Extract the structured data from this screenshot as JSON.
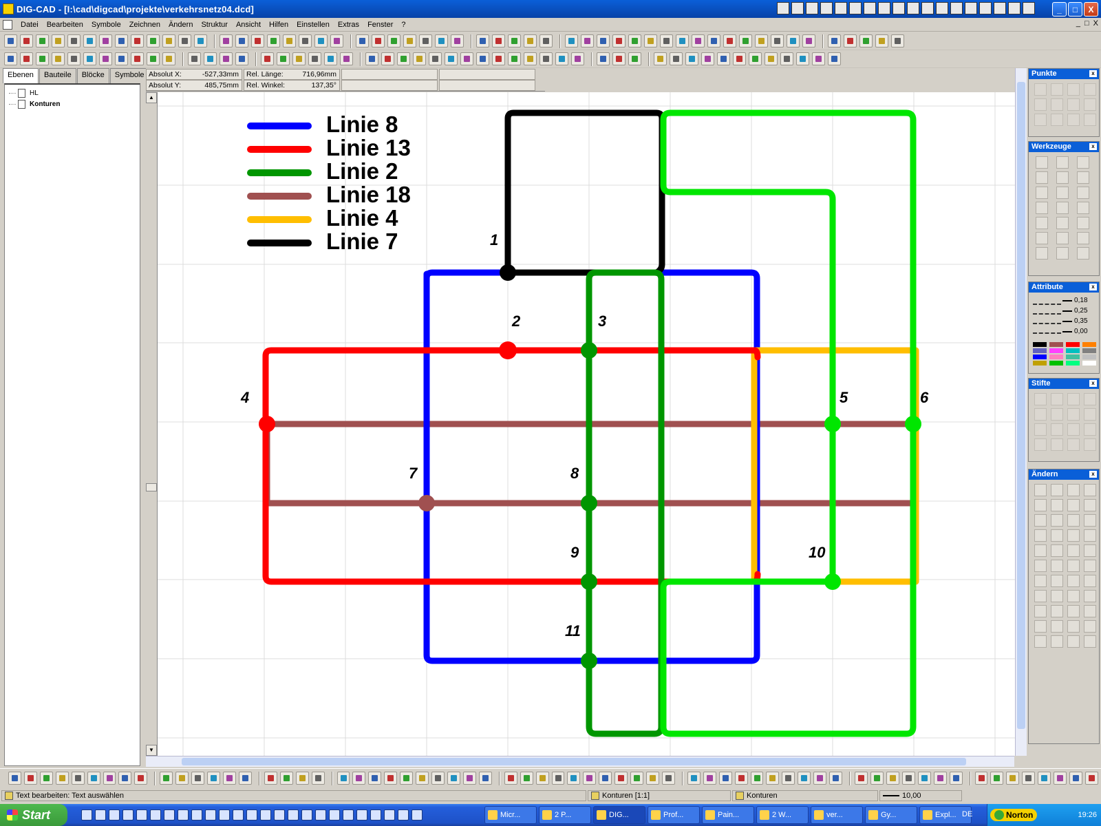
{
  "window": {
    "title": "DIG-CAD - [I:\\cad\\digcad\\projekte\\verkehrsnetz04.dcd]",
    "buttons": [
      "_",
      "□",
      "X"
    ]
  },
  "menu": {
    "items": [
      "Datei",
      "Bearbeiten",
      "Symbole",
      "Zeichnen",
      "Ändern",
      "Struktur",
      "Ansicht",
      "Hilfen",
      "Einstellen",
      "Extras",
      "Fenster",
      "?"
    ],
    "mdi_controls": [
      "_",
      "□",
      "X"
    ]
  },
  "left_panel": {
    "tabs": [
      "Ebenen",
      "Bauteile",
      "Blöcke",
      "Symbole"
    ],
    "active_tab": "Ebenen",
    "tree": [
      {
        "label": "HL",
        "bold": false
      },
      {
        "label": "Konturen",
        "bold": true
      }
    ]
  },
  "coords": {
    "abs_x_label": "Absolut X:",
    "abs_x_value": "-527,33mm",
    "abs_y_label": "Absolut Y:",
    "abs_y_value": "485,75mm",
    "rel_len_label": "Rel. Länge:",
    "rel_len_value": "716,96mm",
    "rel_ang_label": "Rel. Winkel:",
    "rel_ang_value": "137,35°"
  },
  "drawing": {
    "legend": [
      {
        "label": "Linie 8",
        "color": "#0000ff"
      },
      {
        "label": "Linie 13",
        "color": "#ff0000"
      },
      {
        "label": "Linie 2",
        "color": "#009600"
      },
      {
        "label": "Linie 18",
        "color": "#a05050"
      },
      {
        "label": "Linie 4",
        "color": "#ffbe00"
      },
      {
        "label": "Linie 7",
        "color": "#000000"
      }
    ],
    "light_green": "#00e600",
    "nodes": [
      "1",
      "2",
      "3",
      "4",
      "5",
      "6",
      "7",
      "8",
      "9",
      "10",
      "11"
    ]
  },
  "palettes": {
    "punkte": "Punkte",
    "werkzeuge": "Werkzeuge",
    "attribute": "Attribute",
    "stifte": "Stifte",
    "aendern": "Ändern",
    "line_widths": [
      "0,18",
      "0,25",
      "0,35",
      "0,00"
    ],
    "swatches": [
      "#000000",
      "#a05050",
      "#ff0000",
      "#ff8000",
      "#6060c0",
      "#ff40ff",
      "#00c0c0",
      "#808080",
      "#0000ff",
      "#ff80c0",
      "#40c0a0",
      "#c0c0c0",
      "#c0a000",
      "#00c000",
      "#00ff80",
      "#ffffff"
    ]
  },
  "status": {
    "left_text": "Text bearbeiten: Text auswählen",
    "layer": "Konturen [1:1]",
    "layer2": "Konturen",
    "pen": "10,00"
  },
  "taskbar": {
    "start": "Start",
    "tasks": [
      "Micr...",
      "2 P...",
      "DIG...",
      "Prof...",
      "Pain...",
      "2 W...",
      "ver...",
      "Gy...",
      "Expl..."
    ],
    "active_task": "DIG...",
    "lang": "DE",
    "norton": "Norton",
    "clock": "19:26"
  }
}
